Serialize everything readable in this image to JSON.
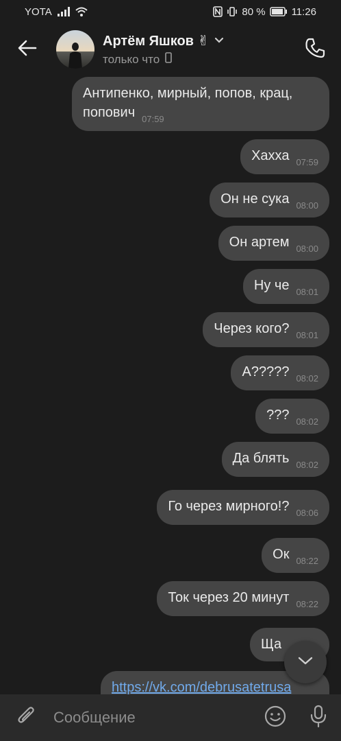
{
  "status_bar": {
    "carrier": "YOTA",
    "battery": "80 %",
    "time": "11:26",
    "icons": [
      "signal-icon",
      "wifi-icon",
      "nfc-icon",
      "vibrate-icon",
      "battery-icon"
    ]
  },
  "header": {
    "contact_name": "Артём Яшков ✌",
    "status": "только что",
    "icons": [
      "back-arrow-icon",
      "avatar",
      "chevron-down-icon",
      "mobile-device-icon",
      "phone-icon"
    ]
  },
  "messages": [
    {
      "text": "Антипенко, мирный, попов, крац, попович",
      "time": "07:59"
    },
    {
      "text": "Хахха",
      "time": "07:59"
    },
    {
      "text": "Он не сука",
      "time": "08:00"
    },
    {
      "text": "Он артем",
      "time": "08:00"
    },
    {
      "text": "Ну че",
      "time": "08:01"
    },
    {
      "text": "Через кого?",
      "time": "08:01"
    },
    {
      "text": "А?????",
      "time": "08:02"
    },
    {
      "text": "???",
      "time": "08:02"
    },
    {
      "text": "Да блять",
      "time": "08:02"
    },
    {
      "text": "Го через мирного!?",
      "time": "08:06"
    },
    {
      "text": "Ок",
      "time": "08:22"
    },
    {
      "text": "Ток через 20 минут",
      "time": "08:22"
    },
    {
      "text": "Ща",
      "time": ""
    },
    {
      "link": "https://vk.com/debrusatetrusa"
    }
  ],
  "composer": {
    "placeholder": "Сообщение",
    "icons": [
      "paperclip-icon",
      "emoji-icon",
      "microphone-icon"
    ]
  },
  "colors": {
    "background": "#1c1c1c",
    "bubble": "#454545",
    "link": "#71aaeb",
    "composer": "#2a2a2a"
  }
}
